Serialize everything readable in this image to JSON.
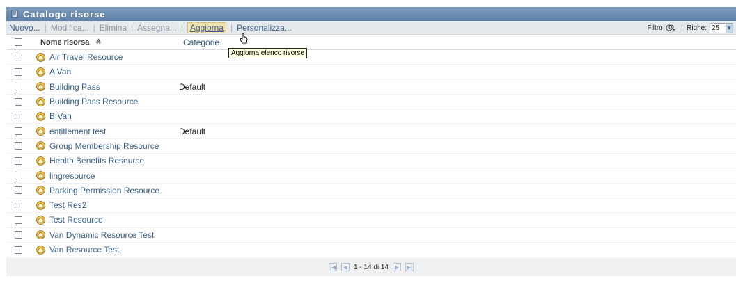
{
  "window": {
    "title": "Catalogo risorse"
  },
  "toolbar": {
    "actions": [
      {
        "label": "Nuovo...",
        "enabled": true
      },
      {
        "label": "Modifica...",
        "enabled": false
      },
      {
        "label": "Elimina",
        "enabled": false
      },
      {
        "label": "Assegna...",
        "enabled": false
      },
      {
        "label": "Aggiorna",
        "enabled": true
      },
      {
        "label": "Personalizza...",
        "enabled": true
      }
    ],
    "filter_label": "Filtro",
    "rows_label": "Righe:",
    "rows_value": "25"
  },
  "table": {
    "columns": {
      "name": "Nome risorsa",
      "sort_indicator": "≜",
      "category": "Categorie"
    },
    "rows": [
      {
        "name": "Air Travel Resource",
        "category": ""
      },
      {
        "name": "A Van",
        "category": ""
      },
      {
        "name": "Building Pass",
        "category": "Default"
      },
      {
        "name": "Building Pass Resource",
        "category": ""
      },
      {
        "name": "B Van",
        "category": ""
      },
      {
        "name": "entitlement test",
        "category": "Default"
      },
      {
        "name": "Group Membership Resource",
        "category": ""
      },
      {
        "name": "Health Benefits Resource",
        "category": ""
      },
      {
        "name": "lingresource",
        "category": ""
      },
      {
        "name": "Parking Permission Resource",
        "category": ""
      },
      {
        "name": "Test Res2",
        "category": ""
      },
      {
        "name": "Test Resource",
        "category": ""
      },
      {
        "name": "Van Dynamic Resource Test",
        "category": ""
      },
      {
        "name": "Van Resource Test",
        "category": ""
      }
    ]
  },
  "pager": {
    "text": "1 - 14 di 14"
  },
  "tooltip": {
    "text": "Aggiorna elenco risorse"
  },
  "colors": {
    "title_bar": "#6f8fb3",
    "link": "#3a5f8a",
    "disabled": "#8a97a6",
    "hover_bg": "#f2e4b2"
  },
  "icons": {
    "title": "catalog-icon",
    "row": "resource-icon",
    "filter": "filter-icon"
  }
}
